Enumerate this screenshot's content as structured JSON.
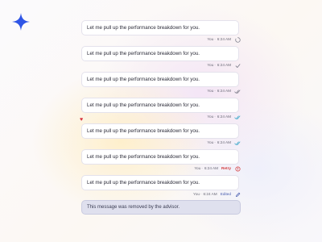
{
  "brand": {
    "icon": "sparkle-icon",
    "color": "#2f55e6"
  },
  "messages": [
    {
      "text": "Let me pull up the performance breakdown for you.",
      "sender": "You",
      "time": "6:24 AM",
      "status": "sending",
      "status_icon": "sending-spinner-icon"
    },
    {
      "text": "Let me pull up the performance breakdown for you.",
      "sender": "You",
      "time": "6:24 AM",
      "status": "sent",
      "status_icon": "check-icon"
    },
    {
      "text": "Let me pull up the performance breakdown for you.",
      "sender": "You",
      "time": "6:24 AM",
      "status": "delivered",
      "status_icon": "double-check-icon"
    },
    {
      "text": "Let me pull up the performance breakdown for you.",
      "sender": "You",
      "time": "6:24 AM",
      "status": "read",
      "status_icon": "double-check-read-icon"
    },
    {
      "text": "Let me pull up the performance breakdown for you.",
      "sender": "You",
      "time": "6:24 AM",
      "status": "read",
      "status_icon": "double-check-read-icon",
      "reaction": "♥"
    },
    {
      "text": "Let me pull up the performance breakdown for you.",
      "sender": "You",
      "time": "6:24 AM",
      "status": "failed",
      "status_icon": "error-icon",
      "retry_label": "Retry"
    },
    {
      "text": "Let me pull up the performance breakdown for you.",
      "sender": "You",
      "time": "6:24 AM",
      "status": "edited",
      "status_icon": "pencil-icon",
      "edited_label": "Edited"
    }
  ],
  "removed_message": {
    "text": "This message was removed by the advisor."
  },
  "colors": {
    "failed": "#d33b3b",
    "read": "#3aa7c9",
    "edited": "#4a5fb0"
  }
}
